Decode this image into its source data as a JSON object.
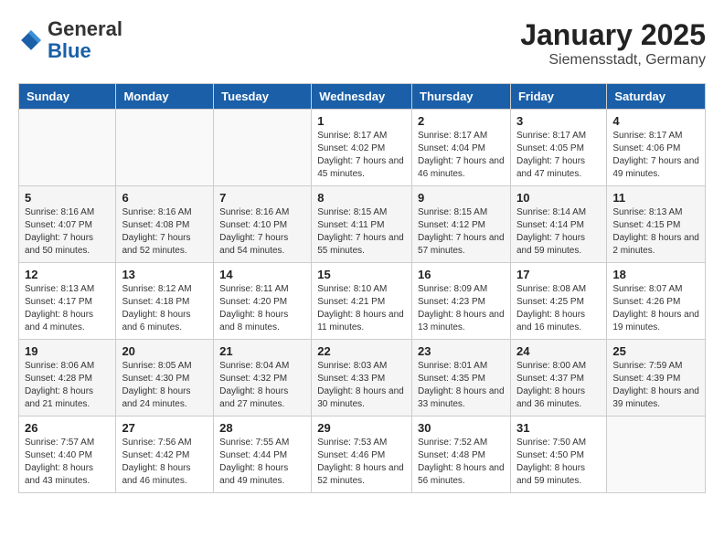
{
  "header": {
    "logo_general": "General",
    "logo_blue": "Blue",
    "title": "January 2025",
    "subtitle": "Siemensstadt, Germany"
  },
  "weekdays": [
    "Sunday",
    "Monday",
    "Tuesday",
    "Wednesday",
    "Thursday",
    "Friday",
    "Saturday"
  ],
  "weeks": [
    [
      {
        "day": "",
        "info": ""
      },
      {
        "day": "",
        "info": ""
      },
      {
        "day": "",
        "info": ""
      },
      {
        "day": "1",
        "info": "Sunrise: 8:17 AM\nSunset: 4:02 PM\nDaylight: 7 hours and 45 minutes."
      },
      {
        "day": "2",
        "info": "Sunrise: 8:17 AM\nSunset: 4:04 PM\nDaylight: 7 hours and 46 minutes."
      },
      {
        "day": "3",
        "info": "Sunrise: 8:17 AM\nSunset: 4:05 PM\nDaylight: 7 hours and 47 minutes."
      },
      {
        "day": "4",
        "info": "Sunrise: 8:17 AM\nSunset: 4:06 PM\nDaylight: 7 hours and 49 minutes."
      }
    ],
    [
      {
        "day": "5",
        "info": "Sunrise: 8:16 AM\nSunset: 4:07 PM\nDaylight: 7 hours and 50 minutes."
      },
      {
        "day": "6",
        "info": "Sunrise: 8:16 AM\nSunset: 4:08 PM\nDaylight: 7 hours and 52 minutes."
      },
      {
        "day": "7",
        "info": "Sunrise: 8:16 AM\nSunset: 4:10 PM\nDaylight: 7 hours and 54 minutes."
      },
      {
        "day": "8",
        "info": "Sunrise: 8:15 AM\nSunset: 4:11 PM\nDaylight: 7 hours and 55 minutes."
      },
      {
        "day": "9",
        "info": "Sunrise: 8:15 AM\nSunset: 4:12 PM\nDaylight: 7 hours and 57 minutes."
      },
      {
        "day": "10",
        "info": "Sunrise: 8:14 AM\nSunset: 4:14 PM\nDaylight: 7 hours and 59 minutes."
      },
      {
        "day": "11",
        "info": "Sunrise: 8:13 AM\nSunset: 4:15 PM\nDaylight: 8 hours and 2 minutes."
      }
    ],
    [
      {
        "day": "12",
        "info": "Sunrise: 8:13 AM\nSunset: 4:17 PM\nDaylight: 8 hours and 4 minutes."
      },
      {
        "day": "13",
        "info": "Sunrise: 8:12 AM\nSunset: 4:18 PM\nDaylight: 8 hours and 6 minutes."
      },
      {
        "day": "14",
        "info": "Sunrise: 8:11 AM\nSunset: 4:20 PM\nDaylight: 8 hours and 8 minutes."
      },
      {
        "day": "15",
        "info": "Sunrise: 8:10 AM\nSunset: 4:21 PM\nDaylight: 8 hours and 11 minutes."
      },
      {
        "day": "16",
        "info": "Sunrise: 8:09 AM\nSunset: 4:23 PM\nDaylight: 8 hours and 13 minutes."
      },
      {
        "day": "17",
        "info": "Sunrise: 8:08 AM\nSunset: 4:25 PM\nDaylight: 8 hours and 16 minutes."
      },
      {
        "day": "18",
        "info": "Sunrise: 8:07 AM\nSunset: 4:26 PM\nDaylight: 8 hours and 19 minutes."
      }
    ],
    [
      {
        "day": "19",
        "info": "Sunrise: 8:06 AM\nSunset: 4:28 PM\nDaylight: 8 hours and 21 minutes."
      },
      {
        "day": "20",
        "info": "Sunrise: 8:05 AM\nSunset: 4:30 PM\nDaylight: 8 hours and 24 minutes."
      },
      {
        "day": "21",
        "info": "Sunrise: 8:04 AM\nSunset: 4:32 PM\nDaylight: 8 hours and 27 minutes."
      },
      {
        "day": "22",
        "info": "Sunrise: 8:03 AM\nSunset: 4:33 PM\nDaylight: 8 hours and 30 minutes."
      },
      {
        "day": "23",
        "info": "Sunrise: 8:01 AM\nSunset: 4:35 PM\nDaylight: 8 hours and 33 minutes."
      },
      {
        "day": "24",
        "info": "Sunrise: 8:00 AM\nSunset: 4:37 PM\nDaylight: 8 hours and 36 minutes."
      },
      {
        "day": "25",
        "info": "Sunrise: 7:59 AM\nSunset: 4:39 PM\nDaylight: 8 hours and 39 minutes."
      }
    ],
    [
      {
        "day": "26",
        "info": "Sunrise: 7:57 AM\nSunset: 4:40 PM\nDaylight: 8 hours and 43 minutes."
      },
      {
        "day": "27",
        "info": "Sunrise: 7:56 AM\nSunset: 4:42 PM\nDaylight: 8 hours and 46 minutes."
      },
      {
        "day": "28",
        "info": "Sunrise: 7:55 AM\nSunset: 4:44 PM\nDaylight: 8 hours and 49 minutes."
      },
      {
        "day": "29",
        "info": "Sunrise: 7:53 AM\nSunset: 4:46 PM\nDaylight: 8 hours and 52 minutes."
      },
      {
        "day": "30",
        "info": "Sunrise: 7:52 AM\nSunset: 4:48 PM\nDaylight: 8 hours and 56 minutes."
      },
      {
        "day": "31",
        "info": "Sunrise: 7:50 AM\nSunset: 4:50 PM\nDaylight: 8 hours and 59 minutes."
      },
      {
        "day": "",
        "info": ""
      }
    ]
  ]
}
